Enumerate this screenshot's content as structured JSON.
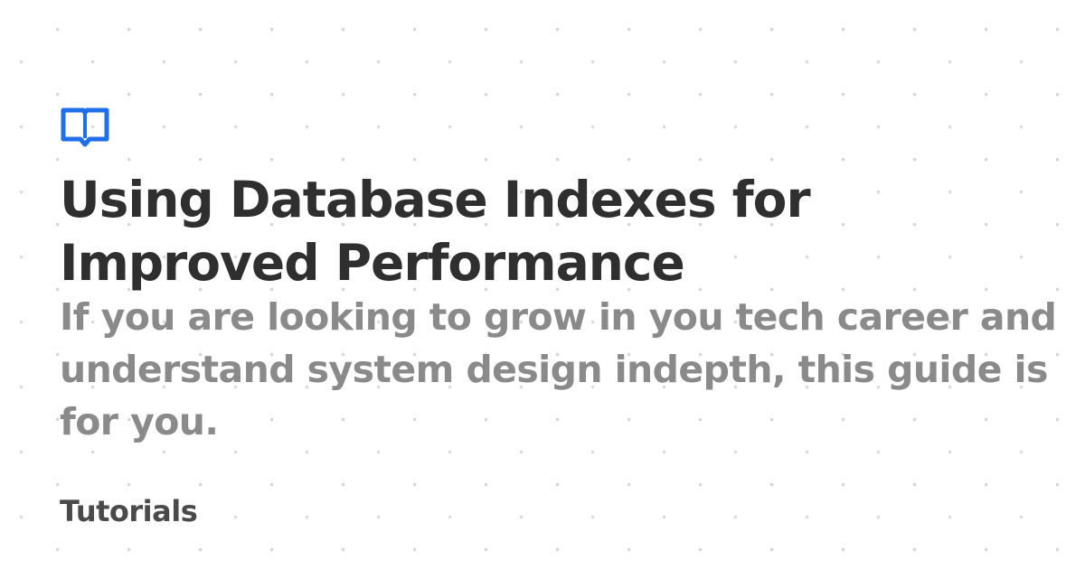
{
  "logo": {
    "icon": "open-book-icon",
    "color": "#1f6feb"
  },
  "article": {
    "title": "Using Database Indexes for Improved Performance",
    "description": "If you are looking to grow in you tech career and understand system design indepth, this guide is for you.",
    "category": "Tutorials"
  },
  "colors": {
    "background": "#ffffff",
    "title": "#2f2f2f",
    "description": "#8a8a8a",
    "category": "#4a4a4a",
    "dots": "#d4d4d4"
  }
}
